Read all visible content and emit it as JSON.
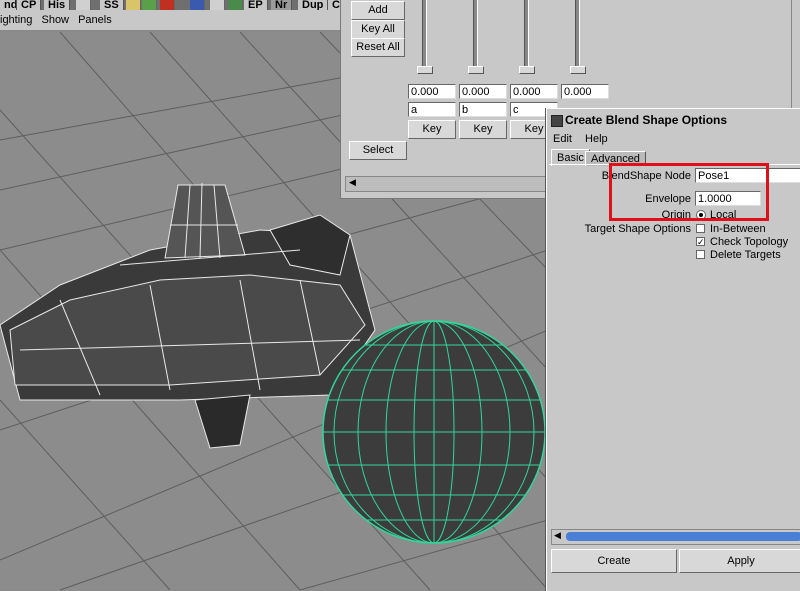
{
  "shelf": {
    "tabs": [
      "nd",
      "CP",
      "His",
      "SS",
      "EP",
      "Nr",
      "Dup",
      "Cp"
    ]
  },
  "viewport": {
    "menu": [
      "ighting",
      "Show",
      "Panels"
    ]
  },
  "blend_editor": {
    "buttons": {
      "add": "Add",
      "key_all": "Key All",
      "reset_all": "Reset All",
      "select": "Select"
    },
    "sliders": [
      {
        "value": "0.000",
        "name": "a",
        "key": "Key"
      },
      {
        "value": "0.000",
        "name": "b",
        "key": "Key"
      },
      {
        "value": "0.000",
        "name": "c",
        "key": "Key"
      },
      {
        "value": "0.000",
        "name": "",
        "key": ""
      }
    ]
  },
  "dialog": {
    "title": "Create Blend Shape Options",
    "menu": [
      "Edit",
      "Help"
    ],
    "tabs": {
      "basic": "Basic",
      "advanced": "Advanced"
    },
    "blendshape_label": "BlendShape Node",
    "blendshape_value": "Pose1",
    "envelope_label": "Envelope",
    "envelope_value": "1.0000",
    "origin_label": "Origin",
    "origin_value": "Local",
    "target_label": "Target Shape Options",
    "in_between": "In-Between",
    "check_topology": "Check Topology",
    "delete_targets": "Delete Targets",
    "create": "Create",
    "apply": "Apply"
  },
  "colors": {
    "highlight": "#e0101a",
    "wire": "#2fd79a",
    "scroll": "#4a7fd6"
  }
}
